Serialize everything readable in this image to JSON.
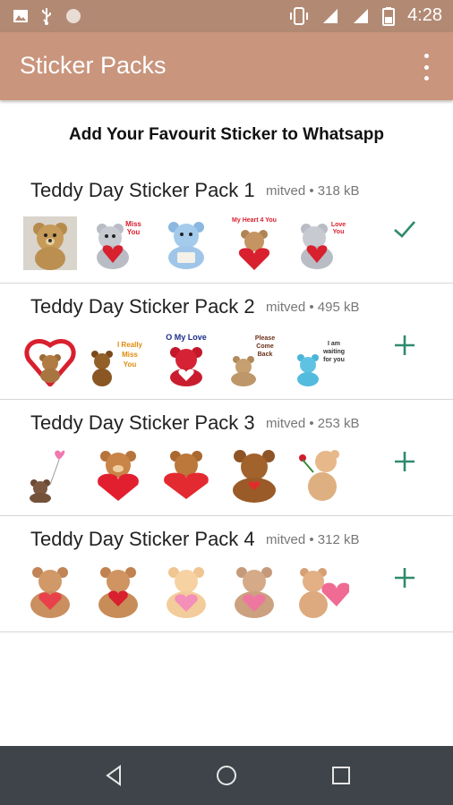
{
  "status_bar": {
    "time": "4:28",
    "left_icons": [
      "image-icon",
      "usb-icon",
      "circle-icon"
    ],
    "right_icons": [
      "vibrate-icon",
      "signal-icon",
      "signal-icon",
      "battery-icon"
    ]
  },
  "app_bar": {
    "title": "Sticker Packs",
    "background": "#c9957d",
    "menu_icon": "more-vert-icon"
  },
  "subtitle": "Add Your Favourit Sticker to Whatsapp",
  "packs": [
    {
      "name": "Teddy Day Sticker Pack 1",
      "publisher": "mitved",
      "separator": "•",
      "size": "318 kB",
      "action_icon": "check-icon",
      "stickers": [
        {
          "text": ""
        },
        {
          "text": "Miss You"
        },
        {
          "text": ""
        },
        {
          "text": "My Heart 4 You"
        },
        {
          "text": "Love You"
        }
      ]
    },
    {
      "name": "Teddy Day Sticker Pack 2",
      "publisher": "mitved",
      "separator": "•",
      "size": "495 kB",
      "action_icon": "add-icon",
      "stickers": [
        {
          "text": ""
        },
        {
          "text": "I Really Miss You"
        },
        {
          "text": "O My Love"
        },
        {
          "text": "Please Come Back"
        },
        {
          "text": "I am waiting for you"
        }
      ]
    },
    {
      "name": "Teddy Day Sticker Pack 3",
      "publisher": "mitved",
      "separator": "•",
      "size": "253 kB",
      "action_icon": "add-icon",
      "stickers": [
        {
          "text": ""
        },
        {
          "text": ""
        },
        {
          "text": ""
        },
        {
          "text": ""
        },
        {
          "text": ""
        }
      ]
    },
    {
      "name": "Teddy Day Sticker Pack 4",
      "publisher": "mitved",
      "separator": "•",
      "size": "312 kB",
      "action_icon": "add-icon",
      "stickers": [
        {
          "text": ""
        },
        {
          "text": ""
        },
        {
          "text": ""
        },
        {
          "text": ""
        },
        {
          "text": ""
        }
      ]
    }
  ],
  "nav_bar": {
    "buttons": [
      "back-icon",
      "home-icon",
      "recents-icon"
    ]
  },
  "colors": {
    "status_bar": "#b28a74",
    "app_bar": "#c9957d",
    "accent": "#2f8a6e",
    "nav_bar": "#3e4449"
  }
}
